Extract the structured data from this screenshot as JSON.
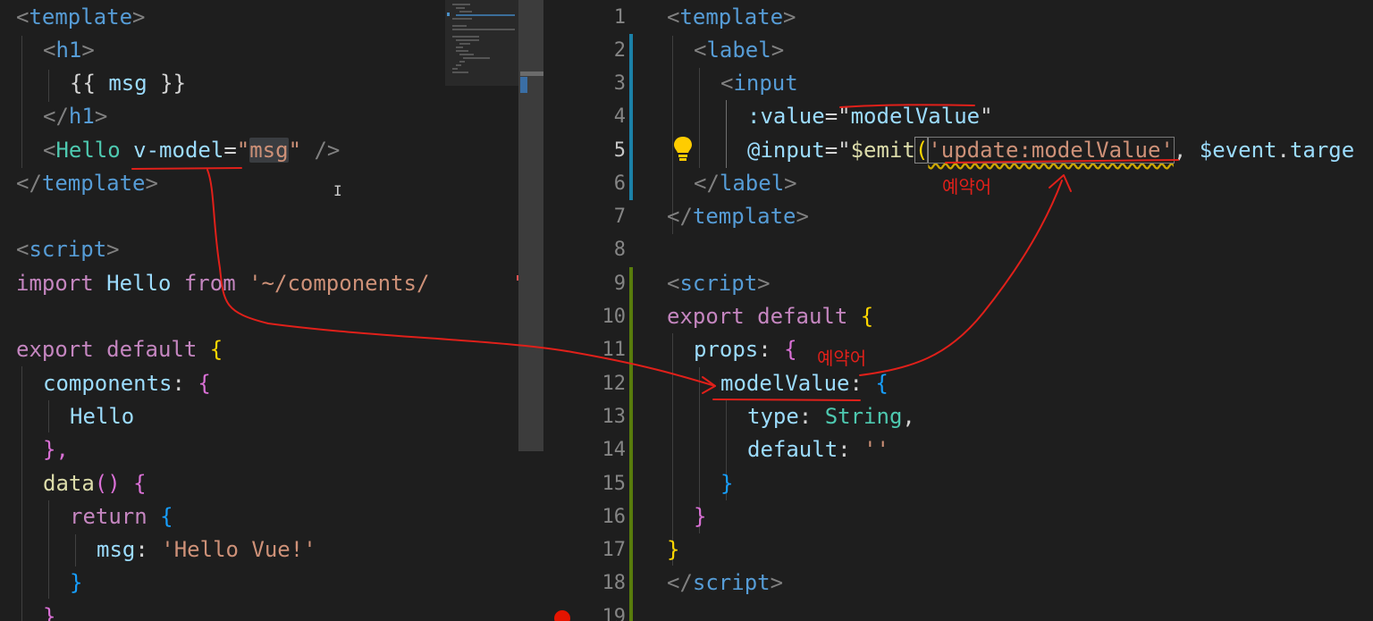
{
  "left_editor": {
    "lines": [
      [
        "<",
        "template",
        ">"
      ],
      [
        "<",
        "h1",
        ">"
      ],
      [
        "{{ ",
        "msg",
        " }}"
      ],
      [
        "</",
        "h1",
        ">"
      ],
      [
        "<",
        "Hello",
        " ",
        "v-model",
        "=",
        "\"",
        "msg",
        "\"",
        " />"
      ],
      [
        "</",
        "template",
        ">"
      ],
      [
        ""
      ],
      [
        "<",
        "script",
        ">"
      ],
      [
        "import",
        " ",
        "Hello",
        " ",
        "from",
        " ",
        "'~/components/"
      ],
      [
        ""
      ],
      [
        "export",
        " ",
        "default",
        " ",
        "{"
      ],
      [
        "components",
        ":",
        " ",
        "{"
      ],
      [
        "Hello"
      ],
      [
        "},"
      ],
      [
        "data",
        "()",
        " ",
        "{"
      ],
      [
        "return",
        " ",
        "{"
      ],
      [
        "msg",
        ":",
        " ",
        "'Hello Vue!'"
      ],
      [
        "}"
      ],
      [
        "}"
      ]
    ]
  },
  "right_editor": {
    "line_numbers": [
      "1",
      "2",
      "3",
      "4",
      "5",
      "6",
      "7",
      "8",
      "9",
      "10",
      "11",
      "12",
      "13",
      "14",
      "15",
      "16",
      "17",
      "18",
      "19"
    ],
    "active_line": "5",
    "lines": [
      [
        "<",
        "template",
        ">"
      ],
      [
        "<",
        "label",
        ">"
      ],
      [
        "<",
        "input"
      ],
      [
        ":value",
        "=",
        "\"",
        "modelValue",
        "\""
      ],
      [
        "@input",
        "=",
        "\"",
        "$emit",
        "(",
        "'update:modelValue'",
        ", ",
        "$event",
        ".",
        "targe"
      ],
      [
        "</",
        "label",
        ">"
      ],
      [
        "</",
        "template",
        ">"
      ],
      [
        ""
      ],
      [
        "<",
        "script",
        ">"
      ],
      [
        "export",
        " ",
        "default",
        " ",
        "{"
      ],
      [
        "props",
        ":",
        " ",
        "{"
      ],
      [
        "modelValue",
        ":",
        " ",
        "{"
      ],
      [
        "type",
        ":",
        " ",
        "String",
        ","
      ],
      [
        "default",
        ":",
        " ",
        "''"
      ],
      [
        "}"
      ],
      [
        "}"
      ],
      [
        "}"
      ],
      [
        "</",
        "script",
        ">"
      ],
      [
        ""
      ]
    ]
  },
  "annotations": {
    "reserved_word_1": "예약어",
    "reserved_word_2": "예약어"
  },
  "colors": {
    "background": "#1e1e1e",
    "annotation_ink": "#e0201a",
    "modified_gutter_blue": "#1b81a8",
    "modified_gutter_green": "#587c0c",
    "breakpoint": "#e51400"
  },
  "icons": {
    "lightbulb": "lightbulb-icon",
    "breakpoint": "breakpoint-dot-icon",
    "text_cursor": "text-cursor-icon"
  }
}
